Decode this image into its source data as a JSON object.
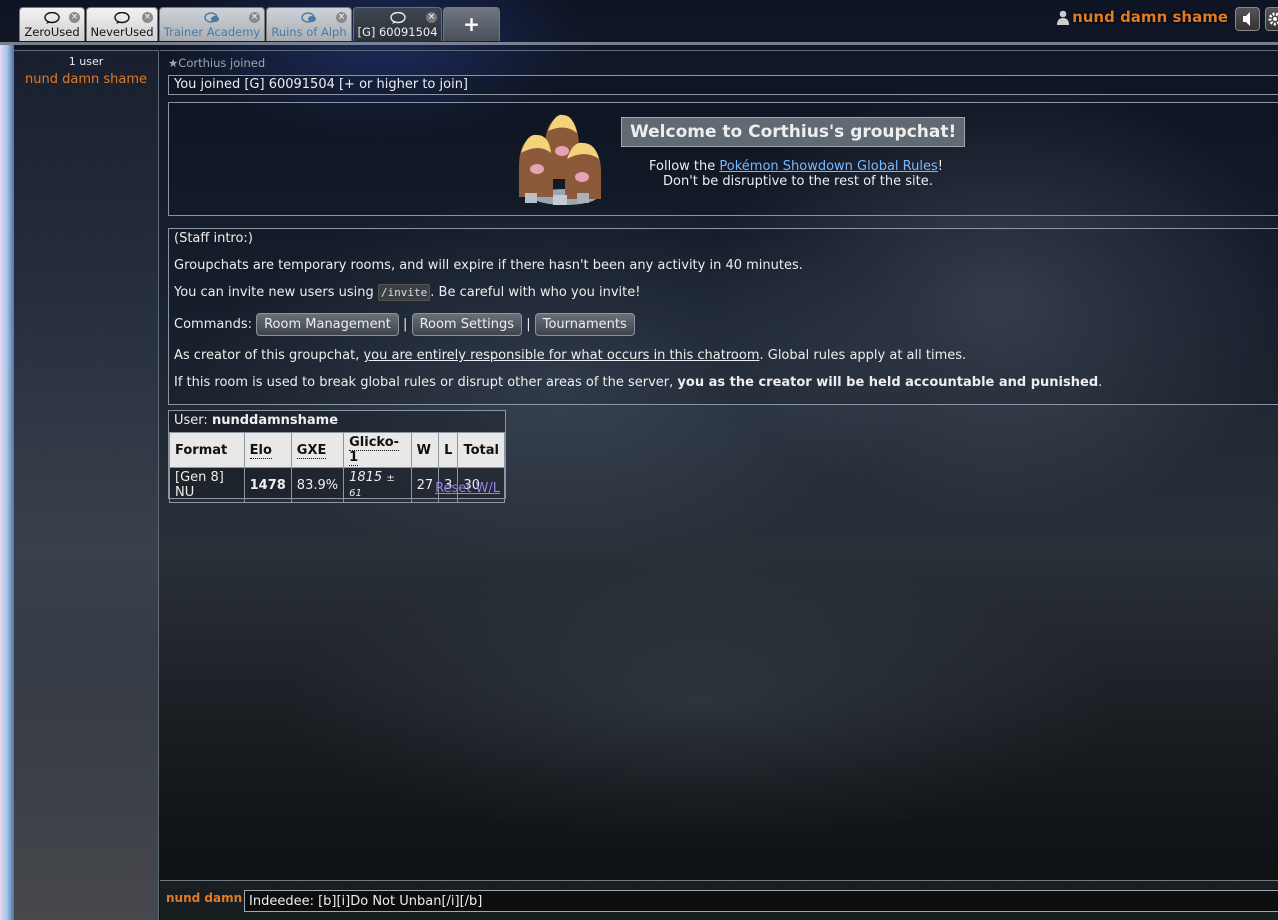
{
  "tabs": [
    {
      "label": "ZeroUsed",
      "state": "normal"
    },
    {
      "label": "NeverUsed",
      "state": "normal"
    },
    {
      "label": "Trainer Academy",
      "state": "inactive"
    },
    {
      "label": "Ruins of Alph",
      "state": "inactive"
    },
    {
      "label": "[G] 60091504",
      "state": "active"
    }
  ],
  "tab_add_label": "+",
  "header": {
    "username": "nund damn shame"
  },
  "userlist": {
    "count": "1 user",
    "users": [
      "nund damn shame"
    ]
  },
  "chat": {
    "notice": "★Corthius joined",
    "joined": "You joined [G] 60091504 [+ or higher to join]",
    "welcome": {
      "title": "Welcome to Corthius's groupchat!",
      "line1_prefix": "Follow the ",
      "line1_link": "Pokémon Showdown Global Rules",
      "line1_suffix": "!",
      "line2": "Don't be disruptive to the rest of the site."
    },
    "staff": {
      "intro": "(Staff intro:)",
      "p1": "Groupchats are temporary rooms, and will expire if there hasn't been any activity in 40 minutes.",
      "p2_prefix": "You can invite new users using ",
      "p2_code": "/invite",
      "p2_suffix": ". Be careful with who you invite!",
      "commands_label": "Commands:",
      "commands": [
        "Room Management",
        "Room Settings",
        "Tournaments"
      ],
      "separator": "|",
      "p4_prefix": "As creator of this groupchat, ",
      "p4_underline": "you are entirely responsible for what occurs in this chatroom",
      "p4_suffix": ". Global rules apply at all times.",
      "p5_prefix": "If this room is used to break global rules or disrupt other areas of the server, ",
      "p5_bold": "you as the creator will be held accountable and punished",
      "p5_suffix": "."
    },
    "rankings": {
      "user_label": "User:",
      "user": "nunddamnshame",
      "headers": [
        "Format",
        "Elo",
        "GXE",
        "Glicko-1",
        "W",
        "L",
        "Total"
      ],
      "row": {
        "format": "[Gen 8] NU",
        "elo": "1478",
        "gxe": "83.9%",
        "glicko": "1815",
        "glicko_dev": "± 61",
        "w": "27",
        "l": "3",
        "total": "30"
      },
      "reset": "Reset W/L"
    }
  },
  "composer": {
    "name": "nund damn",
    "value": "Indeedee: [b][i]Do Not Unban[/i][/b]"
  },
  "colors": {
    "username": "#e07b25",
    "link": "#79b8ff",
    "reset_link": "#9b7fe6"
  }
}
